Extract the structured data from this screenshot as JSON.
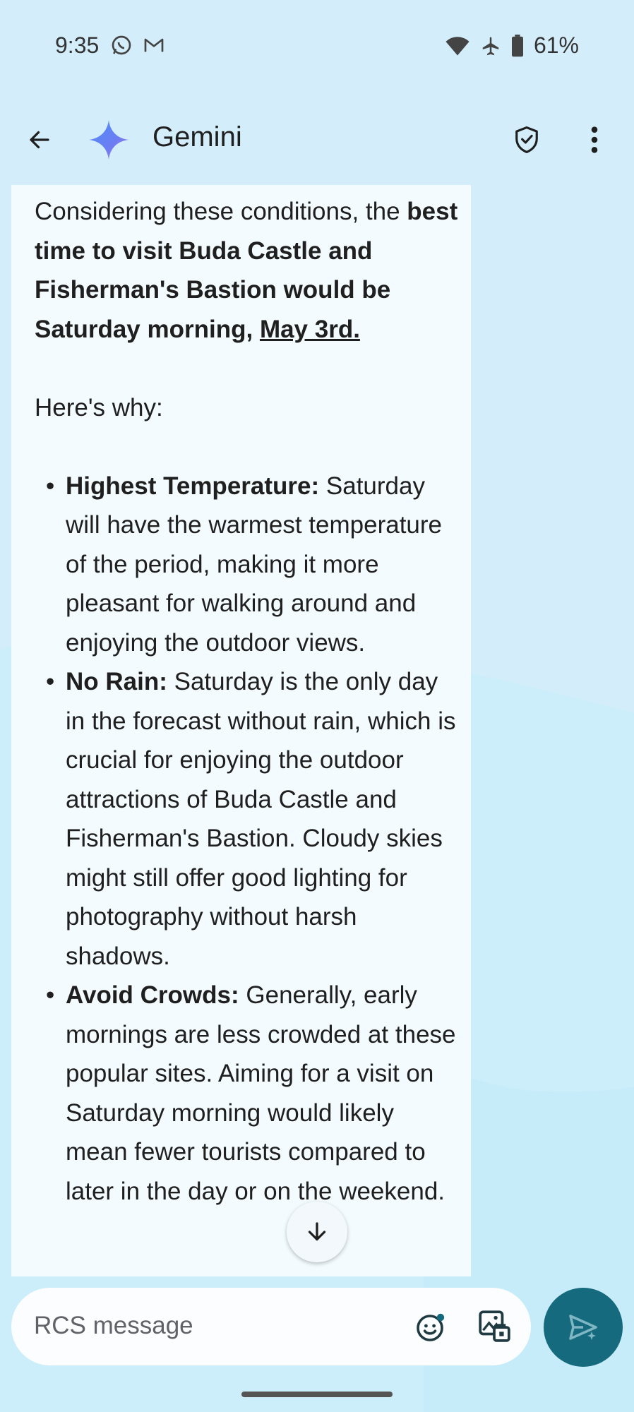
{
  "status_bar": {
    "time": "9:35",
    "battery": "61%"
  },
  "app_bar": {
    "title": "Gemini"
  },
  "message": {
    "intro_plain": "Considering these conditions, the ",
    "intro_bold": "best time to visit Buda Castle and Fisherman's Bastion would be Saturday morning, ",
    "intro_date": "May 3rd.",
    "why": "Here's why:",
    "bullets": [
      {
        "title": "Highest Temperature:",
        "text": " Saturday will have the warmest temperature of the period, making it more pleasant for walking around and enjoying the outdoor views."
      },
      {
        "title": "No Rain:",
        "text": " Saturday is the only day in the forecast without rain, which is crucial for enjoying the outdoor attractions of Buda Castle and Fisherman's Bastion. Cloudy skies might still offer good lighting for photography without harsh shadows."
      },
      {
        "title": "Avoid Crowds:",
        "text": " Generally, early mornings are less crowded at these popular sites. Aiming for a visit on Saturday morning would likely mean fewer tourists compared to later in the day or on the weekend."
      }
    ]
  },
  "composer": {
    "placeholder": "RCS message"
  },
  "colors": {
    "background": "#d3eefa",
    "bubble": "#f3fbff",
    "send_button": "#166a7d"
  },
  "icons": {
    "back": "arrow-left-icon",
    "logo": "gemini-sparkle-icon",
    "shield": "shield-check-icon",
    "more": "more-vert-icon",
    "scroll": "arrow-down-icon",
    "emoji": "emoji-icon",
    "gallery": "gallery-icon",
    "send": "send-icon"
  }
}
